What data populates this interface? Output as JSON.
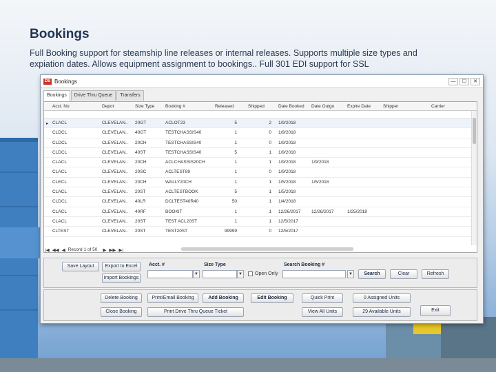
{
  "slide": {
    "title": "Bookings",
    "description": "Full Booking support for steamship line releases or internal releases. Supports multiple size types and expiation dates. Allows equipment assignment to bookings.. Full 301 EDI support for SSL"
  },
  "window": {
    "title": "Bookings",
    "app_icon": "DS",
    "controls": [
      "—",
      "☐",
      "✕"
    ]
  },
  "tabs": [
    "Bookings",
    "Drive Thru Queue",
    "Transfers"
  ],
  "grid": {
    "columns": [
      "Acct. No",
      "Depot",
      "Size Type",
      "Booking #",
      "Released",
      "Shipped",
      "Date Booked",
      "Date Outgo",
      "Expire Date",
      "Shipper",
      "Carrier"
    ],
    "rows": [
      {
        "acct": "CLACL",
        "depot": "CLEVELAN..",
        "size": "20GT",
        "booking": "ACLOT23",
        "released": "5",
        "shipped": "2",
        "booked": "1/9/2018",
        "outgo": "",
        "expire": ""
      },
      {
        "acct": "CLDCL",
        "depot": "CLEVELAN..",
        "size": "40GT",
        "booking": "TESTCHASSIS40",
        "released": "1",
        "shipped": "0",
        "booked": "1/9/2018",
        "outgo": "",
        "expire": ""
      },
      {
        "acct": "CLDCL",
        "depot": "CLEVELAN..",
        "size": "20CH",
        "booking": "TESTCHASSIS40",
        "released": "1",
        "shipped": "0",
        "booked": "1/9/2018",
        "outgo": "",
        "expire": ""
      },
      {
        "acct": "CLDCL",
        "depot": "CLEVELAN..",
        "size": "40ST",
        "booking": "TESTCHASSIS40",
        "released": "5",
        "shipped": "1",
        "booked": "1/9/2018",
        "outgo": "",
        "expire": ""
      },
      {
        "acct": "CLACL",
        "depot": "CLEVELAN..",
        "size": "20CH",
        "booking": "ACLCHASSIS20CH",
        "released": "1",
        "shipped": "1",
        "booked": "1/9/2018",
        "outgo": "1/9/2018",
        "expire": ""
      },
      {
        "acct": "CLACL",
        "depot": "CLEVELAN..",
        "size": "20SC",
        "booking": "ACLTEST89",
        "released": "1",
        "shipped": "0",
        "booked": "1/9/2018",
        "outgo": "",
        "expire": ""
      },
      {
        "acct": "CLECL",
        "depot": "CLEVELAN..",
        "size": "20CH",
        "booking": "WALLY20CH",
        "released": "1",
        "shipped": "1",
        "booked": "1/5/2018",
        "outgo": "1/5/2018",
        "expire": ""
      },
      {
        "acct": "CLACL",
        "depot": "CLEVELAN..",
        "size": "20ST",
        "booking": "ACLTESTBOOK",
        "released": "5",
        "shipped": "1",
        "booked": "1/5/2018",
        "outgo": "",
        "expire": ""
      },
      {
        "acct": "CLDCL",
        "depot": "CLEVELAN..",
        "size": "40LR",
        "booking": "DCLTEST40R40",
        "released": "50",
        "shipped": "1",
        "booked": "1/4/2018",
        "outgo": "",
        "expire": ""
      },
      {
        "acct": "CLACL",
        "depot": "CLEVELAN..",
        "size": "40RF",
        "booking": "BOOKIT",
        "released": "1",
        "shipped": "1",
        "booked": "12/26/2017",
        "outgo": "12/26/2017",
        "expire": "1/25/2018"
      },
      {
        "acct": "CLACL",
        "depot": "CLEVELAN..",
        "size": "20ST",
        "booking": "TEST ACL20ST",
        "released": "1",
        "shipped": "1",
        "booked": "12/5/2017",
        "outgo": "",
        "expire": ""
      },
      {
        "acct": "CLTEST",
        "depot": "CLEVELAN..",
        "size": "20ST",
        "booking": "TEST20ST",
        "released": "99999",
        "shipped": "0",
        "booked": "12/5/2017",
        "outgo": "",
        "expire": ""
      }
    ]
  },
  "nav": {
    "record_label": "Record 1 of 50"
  },
  "filters": {
    "save_layout": "Save Layout",
    "export_excel": "Export to Excel",
    "import_bookings": "Import Bookings",
    "acct_label": "Acct. #",
    "size_type_label": "Size Type",
    "open_only_label": "Open Only",
    "search_booking_label": "Search Booking #",
    "search": "Search",
    "clear": "Clear",
    "refresh": "Refresh"
  },
  "actions": {
    "delete_booking": "Delete Booking",
    "close_booking": "Close Booking",
    "print_email_booking": "Print/Email Booking",
    "print_drive_thru": "Print Drive Thru Queue Ticket",
    "add_booking": "Add Booking",
    "edit_booking": "Edit Booking",
    "quick_print": "Quick Print",
    "view_all_units": "View All Units",
    "assigned_units": "0 Assigned Units",
    "available_units": "29 Available Units",
    "exit": "Exit"
  }
}
